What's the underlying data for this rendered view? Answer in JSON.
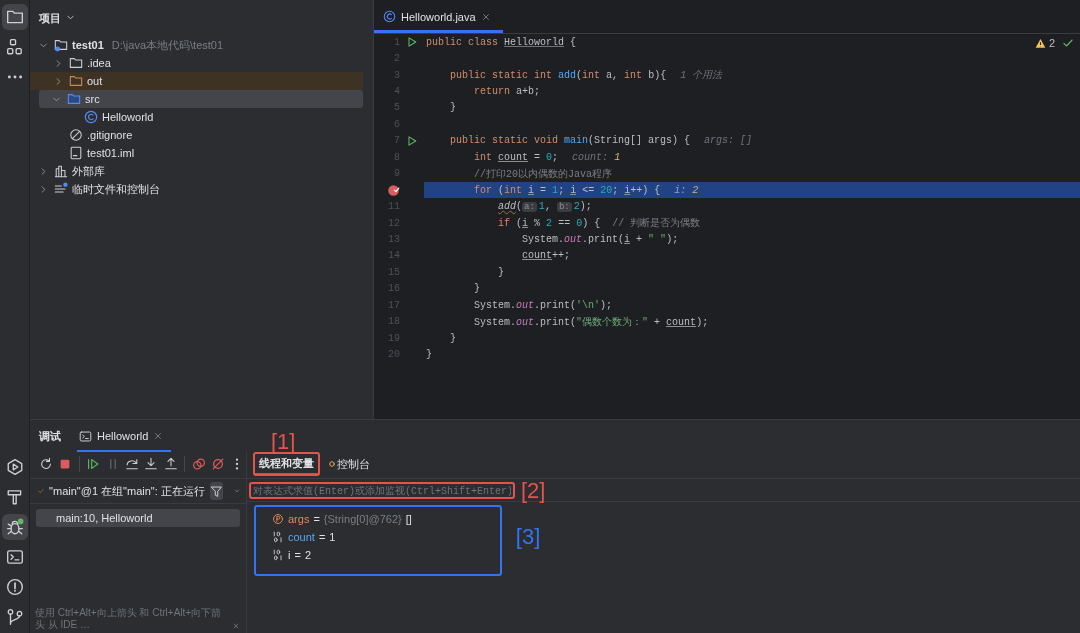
{
  "tool_strip": {
    "top": [
      {
        "kind": "folder",
        "selected": true
      },
      {
        "kind": "structure",
        "selected": false
      },
      {
        "kind": "more",
        "selected": false
      }
    ],
    "bottom": [
      {
        "kind": "run",
        "selected": false
      },
      {
        "kind": "build",
        "selected": false
      },
      {
        "kind": "debug",
        "selected": true
      },
      {
        "kind": "terminal",
        "selected": false
      },
      {
        "kind": "problems",
        "selected": false
      },
      {
        "kind": "git",
        "selected": false
      }
    ]
  },
  "project": {
    "title": "项目",
    "tree": [
      {
        "label": "test01",
        "path": "D:\\java本地代码\\test01",
        "kind": "module",
        "expanded": true,
        "selected": false,
        "children": [
          {
            "label": ".idea",
            "kind": "folder",
            "expanded": false,
            "selected": false
          },
          {
            "label": "out",
            "kind": "excluded_folder",
            "expanded": false,
            "selected": false
          },
          {
            "label": "src",
            "kind": "source_folder",
            "expanded": true,
            "selected": true,
            "children": [
              {
                "label": "Helloworld",
                "kind": "class",
                "selected": false
              }
            ]
          },
          {
            "label": ".gitignore",
            "kind": "ignore",
            "selected": false
          },
          {
            "label": "test01.iml",
            "kind": "file",
            "selected": false
          }
        ]
      },
      {
        "label": "外部库",
        "kind": "library",
        "expanded": false,
        "selected": false
      },
      {
        "label": "临时文件和控制台",
        "kind": "scratch",
        "expanded": false,
        "selected": false
      }
    ]
  },
  "editor": {
    "tabs": [
      {
        "label": "Helloworld.java",
        "selected": true
      }
    ],
    "warnings": "2",
    "lines": [
      {
        "number": "1",
        "kind": "run",
        "current": false,
        "tokens": [
          {
            "kind": "keyword",
            "text": "public class "
          },
          {
            "kind": "class_ref",
            "text": "Helloworld"
          },
          {
            "kind": "plain",
            "text": " {"
          }
        ]
      },
      {
        "number": "2",
        "kind": "code",
        "current": false
      },
      {
        "number": "3",
        "kind": "code",
        "current": false,
        "tokens": [
          {
            "kind": "keyword",
            "text": "    public static int "
          },
          {
            "kind": "method",
            "text": "add"
          },
          {
            "kind": "plain",
            "text": "("
          },
          {
            "kind": "keyword",
            "text": "int "
          },
          {
            "kind": "plain",
            "text": "a, "
          },
          {
            "kind": "keyword",
            "text": "int "
          },
          {
            "kind": "plain",
            "text": "b){"
          }
        ],
        "hint": [
          {
            "kind": "hint",
            "text": "1 个用法"
          }
        ]
      },
      {
        "number": "4",
        "kind": "code",
        "current": false,
        "tokens": [
          {
            "kind": "keyword",
            "text": "        return "
          },
          {
            "kind": "plain",
            "text": "a+b;"
          }
        ]
      },
      {
        "number": "5",
        "kind": "code",
        "current": false,
        "tokens": [
          {
            "kind": "plain",
            "text": "    }"
          }
        ]
      },
      {
        "number": "6",
        "kind": "code",
        "current": false
      },
      {
        "number": "7",
        "kind": "run",
        "current": false,
        "tokens": [
          {
            "kind": "keyword",
            "text": "    public static void "
          },
          {
            "kind": "method",
            "text": "main"
          },
          {
            "kind": "plain",
            "text": "(String[] args) {"
          }
        ],
        "hint": [
          {
            "kind": "hint",
            "text": "args: []"
          }
        ]
      },
      {
        "number": "8",
        "kind": "code",
        "current": false,
        "tokens": [
          {
            "kind": "keyword",
            "text": "        int "
          },
          {
            "kind": "variable",
            "text": "count"
          },
          {
            "kind": "plain",
            "text": " = "
          },
          {
            "kind": "number",
            "text": "0"
          },
          {
            "kind": "plain",
            "text": ";"
          }
        ],
        "hint": [
          {
            "kind": "hint",
            "text": "count: "
          },
          {
            "kind": "hint_value",
            "text": "1"
          }
        ]
      },
      {
        "number": "9",
        "kind": "code",
        "current": false,
        "tokens": [
          {
            "kind": "comment",
            "text": "        //打印20以内偶数的Java程序"
          }
        ]
      },
      {
        "kind": "breakpoint",
        "current": true,
        "tokens": [
          {
            "kind": "keyword",
            "text": "        for "
          },
          {
            "kind": "plain",
            "text": "("
          },
          {
            "kind": "keyword",
            "text": "int "
          },
          {
            "kind": "variable",
            "text": "i"
          },
          {
            "kind": "plain",
            "text": " = "
          },
          {
            "kind": "number",
            "text": "1"
          },
          {
            "kind": "plain",
            "text": "; "
          },
          {
            "kind": "variable",
            "text": "i"
          },
          {
            "kind": "plain",
            "text": " <= "
          },
          {
            "kind": "number",
            "text": "20"
          },
          {
            "kind": "plain",
            "text": "; "
          },
          {
            "kind": "variable",
            "text": "i"
          },
          {
            "kind": "plain",
            "text": "++) {"
          }
        ],
        "hint": [
          {
            "kind": "hint",
            "text": "i: "
          },
          {
            "kind": "hint_value",
            "text": "2"
          }
        ]
      },
      {
        "number": "11",
        "kind": "code",
        "current": false,
        "tokens": [
          {
            "kind": "static_call",
            "text": "            add"
          },
          {
            "kind": "plain",
            "text": "("
          },
          {
            "kind": "inlay",
            "text": "a:"
          },
          {
            "kind": "number",
            "text": "1"
          },
          {
            "kind": "plain",
            "text": ", "
          },
          {
            "kind": "inlay",
            "text": "b:"
          },
          {
            "kind": "number",
            "text": "2"
          },
          {
            "kind": "plain",
            "text": ");"
          }
        ]
      },
      {
        "number": "12",
        "kind": "code",
        "current": false,
        "tokens": [
          {
            "kind": "keyword",
            "text": "            if "
          },
          {
            "kind": "plain",
            "text": "("
          },
          {
            "kind": "variable",
            "text": "i"
          },
          {
            "kind": "plain",
            "text": " % "
          },
          {
            "kind": "number",
            "text": "2"
          },
          {
            "kind": "plain",
            "text": " == "
          },
          {
            "kind": "number",
            "text": "0"
          },
          {
            "kind": "plain",
            "text": ") {  "
          },
          {
            "kind": "comment",
            "text": "// 判断是否为偶数"
          }
        ]
      },
      {
        "number": "13",
        "kind": "code",
        "current": false,
        "tokens": [
          {
            "kind": "plain",
            "text": "                System."
          },
          {
            "kind": "field",
            "text": "out"
          },
          {
            "kind": "plain",
            "text": ".print("
          },
          {
            "kind": "variable",
            "text": "i"
          },
          {
            "kind": "plain",
            "text": " + "
          },
          {
            "kind": "string",
            "text": "\" \""
          },
          {
            "kind": "plain",
            "text": ");"
          }
        ]
      },
      {
        "number": "14",
        "kind": "code",
        "current": false,
        "tokens": [
          {
            "kind": "variable",
            "text": "                count"
          },
          {
            "kind": "plain",
            "text": "++;"
          }
        ]
      },
      {
        "number": "15",
        "kind": "code",
        "current": false,
        "tokens": [
          {
            "kind": "plain",
            "text": "            }"
          }
        ]
      },
      {
        "number": "16",
        "kind": "code",
        "current": false,
        "tokens": [
          {
            "kind": "plain",
            "text": "        }"
          }
        ]
      },
      {
        "number": "17",
        "kind": "code",
        "current": false,
        "tokens": [
          {
            "kind": "plain",
            "text": "        System."
          },
          {
            "kind": "field",
            "text": "out"
          },
          {
            "kind": "plain",
            "text": ".print("
          },
          {
            "kind": "string",
            "text": "'\\n'"
          },
          {
            "kind": "plain",
            "text": ");"
          }
        ]
      },
      {
        "number": "18",
        "kind": "code",
        "current": false,
        "tokens": [
          {
            "kind": "plain",
            "text": "        System."
          },
          {
            "kind": "field",
            "text": "out"
          },
          {
            "kind": "plain",
            "text": ".print("
          },
          {
            "kind": "string",
            "text": "\"偶数个数为：\""
          },
          {
            "kind": "plain",
            "text": " + "
          },
          {
            "kind": "variable",
            "text": "count"
          },
          {
            "kind": "plain",
            "text": ");"
          }
        ]
      },
      {
        "number": "19",
        "kind": "code",
        "current": false,
        "tokens": [
          {
            "kind": "plain",
            "text": "    }"
          }
        ]
      },
      {
        "number": "20",
        "kind": "code",
        "current": false,
        "tokens": [
          {
            "kind": "plain",
            "text": "}"
          }
        ]
      }
    ]
  },
  "debug": {
    "title": "调试",
    "tabs": [
      {
        "label": "Helloworld",
        "selected": true
      }
    ],
    "toolbar": [
      {
        "kind": "rerun",
        "disabled": false,
        "separator_before": false
      },
      {
        "kind": "stop",
        "disabled": false,
        "separator_before": false
      },
      {
        "kind": "resume",
        "disabled": false,
        "separator_before": true
      },
      {
        "kind": "pause",
        "disabled": true,
        "separator_before": false
      },
      {
        "kind": "step_over",
        "disabled": false,
        "separator_before": false
      },
      {
        "kind": "step_into",
        "disabled": false,
        "separator_before": false
      },
      {
        "kind": "step_out",
        "disabled": false,
        "separator_before": false
      },
      {
        "kind": "breakpoints",
        "disabled": false,
        "separator_before": true
      },
      {
        "kind": "mute",
        "disabled": false,
        "separator_before": false
      },
      {
        "kind": "more",
        "disabled": false,
        "separator_before": false
      }
    ],
    "thread": {
      "label": "\"main\"@1 在组\"main\": 正在运行"
    },
    "frames": [
      {
        "label": "main:10, Helloworld",
        "selected": true
      }
    ],
    "hint_bar": {
      "text": "使用 Ctrl+Alt+向上箭头 和 Ctrl+Alt+向下箭头 从 IDE …"
    },
    "subtabs": [
      {
        "label": "线程和变量",
        "selected": true
      },
      {
        "label": "控制台",
        "selected": false
      }
    ],
    "evaluate": {
      "placeholder": "对表达式求值(Enter)或添加监视(Ctrl+Shift+Enter)"
    },
    "variables": [
      {
        "kind": "param",
        "name": "args",
        "separator": "=",
        "type_ref": "{String[0]@762}",
        "value": "[]",
        "modified": false
      },
      {
        "kind": "primitive",
        "name": "count",
        "separator": "=",
        "value": "1",
        "modified": true
      },
      {
        "kind": "primitive",
        "name": "i",
        "separator": "=",
        "value": "2",
        "modified": false
      }
    ],
    "annotations": [
      {
        "kind": "subtab",
        "label": "[1]",
        "color": "#e5534b"
      },
      {
        "kind": "evaluate",
        "label": "[2]",
        "color": "#e5534b"
      },
      {
        "kind": "variables",
        "label": "[3]",
        "color": "#3574f0"
      }
    ]
  }
}
